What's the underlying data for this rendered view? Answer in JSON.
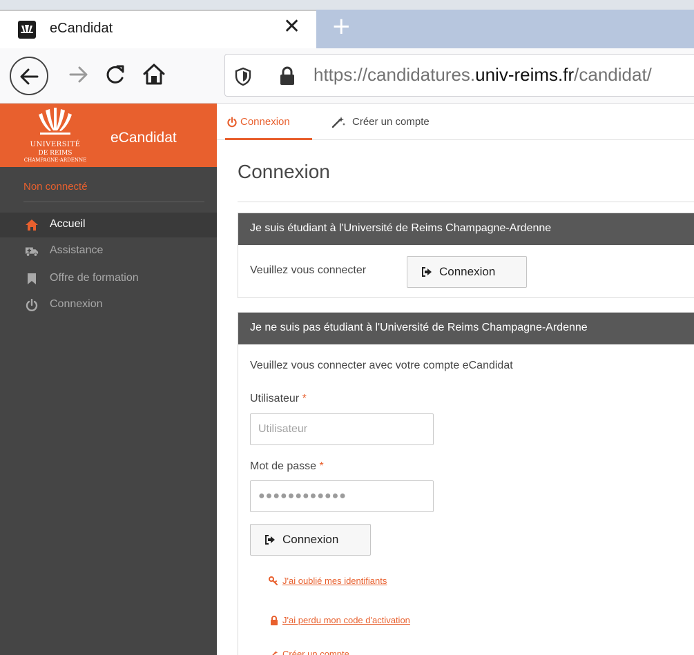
{
  "browser": {
    "tab_title": "eCandidat",
    "close_glyph": "✕",
    "newtab_glyph": "+",
    "url_prefix": "https://candidatures.",
    "url_domain": "univ-reims.fr",
    "url_path": "/candidat/"
  },
  "sidebar": {
    "logo_line1": "UNIVERSITÉ",
    "logo_line2": "DE REIMS",
    "logo_line3": "CHAMPAGNE-ARDENNE",
    "app_name": "eCandidat",
    "status": "Non connecté",
    "items": [
      {
        "label": "Accueil",
        "icon": "home-icon"
      },
      {
        "label": "Assistance",
        "icon": "ambulance-icon"
      },
      {
        "label": "Offre de formation",
        "icon": "bookmark-icon"
      },
      {
        "label": "Connexion",
        "icon": "power-icon"
      }
    ]
  },
  "tabs": [
    {
      "label": "Connexion",
      "icon": "power-icon",
      "selected": true
    },
    {
      "label": "Créer un compte",
      "icon": "magic-wand-icon",
      "selected": false
    }
  ],
  "page": {
    "title": "Connexion",
    "student_panel": {
      "header": "Je suis étudiant à l'Université de Reims Champagne-Ardenne",
      "prompt": "Veuillez vous connecter",
      "button": "Connexion"
    },
    "external_panel": {
      "header": "Je ne suis pas étudiant à l'Université de Reims Champagne-Ardenne",
      "prompt": "Veuillez vous connecter avec votre compte eCandidat",
      "user_label": "Utilisateur",
      "user_placeholder": "Utilisateur",
      "password_label": "Mot de passe",
      "password_value": "●●●●●●●●●●●●",
      "required_mark": "*",
      "button": "Connexion",
      "links": {
        "forgot_ids": "J'ai oublié mes identifiants",
        "lost_code": "J'ai perdu mon code d'activation",
        "create_account": "Créer un compte"
      }
    }
  },
  "colors": {
    "accent": "#e8602e",
    "sidebar_bg": "#454545",
    "panel_header": "#585858"
  }
}
